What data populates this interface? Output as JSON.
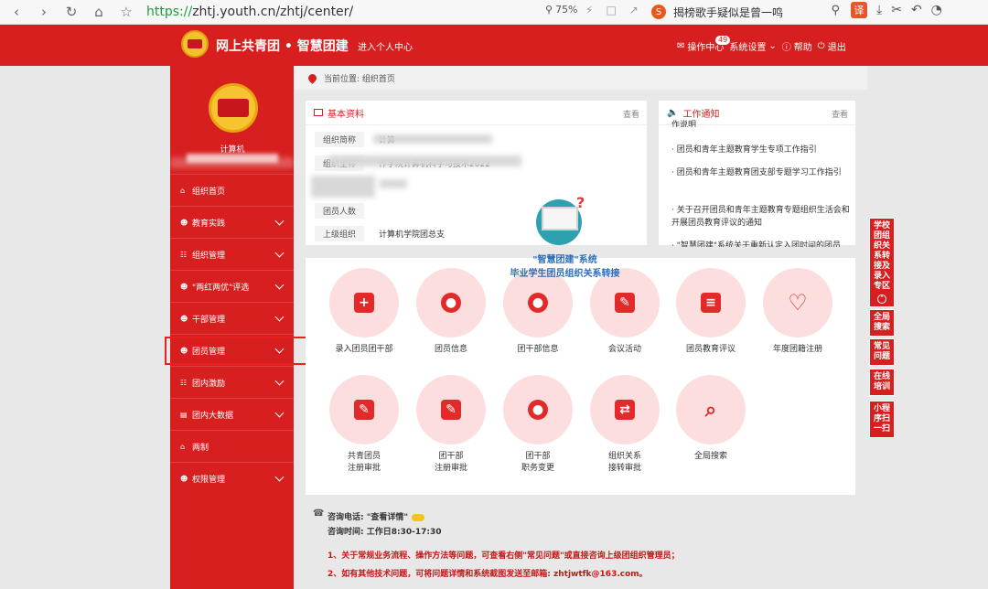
{
  "browser": {
    "url_proto": "https://",
    "url_rest": "zhtj.youth.cn/zhtj/center/",
    "zoom": "75%",
    "search_text": "揭榜歌手疑似是曾一鸣",
    "translate_label": "译"
  },
  "header": {
    "title": "网上共青团 • 智慧团建",
    "personal_center": "进入个人中心",
    "ops_center": "操作中心",
    "badge": "49",
    "settings": "系统设置",
    "help": "帮助",
    "logout": "退出"
  },
  "sidebar": {
    "org_name": "计算机",
    "items": [
      {
        "label": "组织首页",
        "icon": "home-icon",
        "chevron": false
      },
      {
        "label": "教育实践",
        "icon": "users-icon",
        "chevron": true
      },
      {
        "label": "组织管理",
        "icon": "sitemap-icon",
        "chevron": true
      },
      {
        "label": "\"两红两优\"评选",
        "icon": "users-icon",
        "chevron": true
      },
      {
        "label": "干部管理",
        "icon": "users-icon",
        "chevron": true
      },
      {
        "label": "团员管理",
        "icon": "users-icon",
        "chevron": true
      },
      {
        "label": "团内激励",
        "icon": "sitemap-icon",
        "chevron": true
      },
      {
        "label": "团内大数据",
        "icon": "folder-icon",
        "chevron": true
      },
      {
        "label": "两制",
        "icon": "home-icon",
        "chevron": false
      },
      {
        "label": "权限管理",
        "icon": "users-icon",
        "chevron": true
      }
    ]
  },
  "breadcrumb": "当前位置: 组织首页",
  "basic_info": {
    "title": "基本资料",
    "view": "查看",
    "rows": [
      {
        "label": "组织简称",
        "value": "计算"
      },
      {
        "label": "组织全称",
        "value": "作学院计算机科学与技术2022"
      },
      {
        "label": "组织类别",
        "value": ""
      },
      {
        "label": "团员人数",
        "value": ""
      },
      {
        "label": "上级组织",
        "value": "计算机学院团总支"
      }
    ]
  },
  "notice": {
    "title": "工作通知",
    "view": "查看",
    "items": [
      "作说明",
      "· 团员和青年主题教育学生专项工作指引",
      "· 团员和青年主题教育团支部专题学习工作指引",
      "· 关于召开团员和青年主题教育专题组织生活会和开展团员教育评议的通知",
      "· \"智慧团建\"系统关于重新认定入团时间的团员"
    ]
  },
  "popup": {
    "line1": "\"智慧团建\"系统",
    "line2": "毕业学生团员组织关系转接"
  },
  "functions": [
    {
      "label": "录入团员团干部",
      "icon": "plus-icon",
      "glyph": "+"
    },
    {
      "label": "团员信息",
      "icon": "user-icon",
      "glyph": "●"
    },
    {
      "label": "团干部信息",
      "icon": "group-icon",
      "glyph": "●"
    },
    {
      "label": "会议活动",
      "icon": "edit-icon",
      "glyph": "✎"
    },
    {
      "label": "团员教育评议",
      "icon": "document-icon",
      "glyph": "≡"
    },
    {
      "label": "年度团籍注册",
      "icon": "heart-icon",
      "glyph": "♡"
    },
    {
      "label": "共青团员\n注册审批",
      "icon": "edit-icon",
      "glyph": "✎"
    },
    {
      "label": "团干部\n注册审批",
      "icon": "edit-icon",
      "glyph": "✎"
    },
    {
      "label": "团干部\n职务变更",
      "icon": "user-icon",
      "glyph": "●"
    },
    {
      "label": "组织关系\n接转审批",
      "icon": "transfer-icon",
      "glyph": "⇄"
    },
    {
      "label": "全局搜索",
      "icon": "search-icon",
      "glyph": "⌕"
    }
  ],
  "contact": {
    "phone": "咨询电话: \"查看详情\"",
    "hours": "咨询时间: 工作日8:30-17:30",
    "note1": "1、关于常规业务流程、操作方法等问题，可查看右侧\"常见问题\"或直接咨询上级团组织管理员；",
    "note2": "2、如有其他技术问题，可将问题详情和系统截图发送至邮箱: zhtjwtfk@163.com。"
  },
  "side_buttons": [
    {
      "label": "学校团组织关系转接及录入专区"
    },
    {
      "label": "全局搜索"
    },
    {
      "label": "常见问题"
    },
    {
      "label": "在线培训"
    },
    {
      "label": "小程序扫一扫"
    }
  ],
  "colors": {
    "brand_red": "#d71f1f",
    "pink": "#fcdede",
    "popup_blue": "#2d6fb8"
  }
}
